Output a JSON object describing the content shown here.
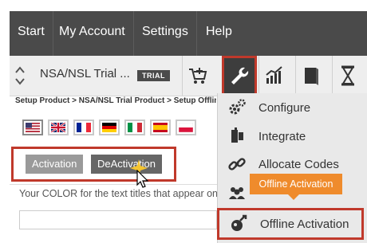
{
  "topnav": {
    "items": [
      {
        "label": "Start"
      },
      {
        "label": "My Account"
      },
      {
        "label": "Settings"
      },
      {
        "label": "Help"
      }
    ]
  },
  "toolbar": {
    "product_name": "NSA/NSL Trial ...",
    "badge": "TRIAL",
    "icons": [
      "cart-add-icon",
      "wrench-icon",
      "chart-icon",
      "book-icon",
      "hourglass-icon"
    ]
  },
  "breadcrumb": "Setup Product > NSA/NSL Trial Product > Setup Offline Activation",
  "flags": [
    "us",
    "uk",
    "france",
    "germany",
    "italy",
    "spain",
    "poland"
  ],
  "tabs": [
    {
      "label": "Activation"
    },
    {
      "label": "DeActivation"
    }
  ],
  "info_text": "Your COLOR for the text titles that appear on the page",
  "dropdown": {
    "items": [
      {
        "label": "Configure",
        "icon": "gears-icon"
      },
      {
        "label": "Integrate",
        "icon": "integrate-icon"
      },
      {
        "label": "Allocate Codes",
        "icon": "link-icon"
      },
      {
        "label": "",
        "icon": "users-icon"
      },
      {
        "label": "Offline Activation",
        "icon": "offline-activation-icon"
      }
    ]
  },
  "tooltip": "Offline Activation",
  "colors": {
    "nav_bg": "#4a4a4a",
    "highlight_border": "#c0392b",
    "tooltip_bg": "#ef8b2c"
  }
}
